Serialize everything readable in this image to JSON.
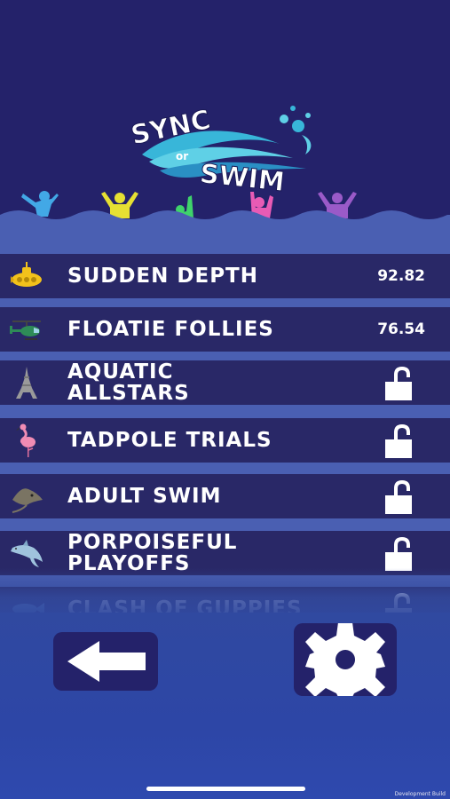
{
  "logo": {
    "text_line1": "SYNC",
    "text_line2": "or",
    "text_line3": "SWIM"
  },
  "levels": [
    {
      "name": "SUDDEN DEPTH",
      "icon": "submarine-icon",
      "score": "92.82",
      "locked": false
    },
    {
      "name": "FLOATIE FOLLIES",
      "icon": "helicopter-icon",
      "score": "76.54",
      "locked": false
    },
    {
      "name": "AQUATIC\nALLSTARS",
      "icon": "eiffel-tower-icon",
      "score": "",
      "locked": true
    },
    {
      "name": "TADPOLE TRIALS",
      "icon": "flamingo-icon",
      "score": "",
      "locked": true
    },
    {
      "name": "ADULT SWIM",
      "icon": "stingray-icon",
      "score": "",
      "locked": true
    },
    {
      "name": "PORPOISEFUL\nPLAYOFFS",
      "icon": "dolphin-icon",
      "score": "",
      "locked": true
    },
    {
      "name": "CLASH OF GUPPIES",
      "icon": "fish-icon",
      "score": "",
      "locked": true
    }
  ],
  "buttons": {
    "back": "back-arrow-icon",
    "settings": "gear-icon"
  },
  "footer": {
    "dev_build": "Development Build"
  },
  "colors": {
    "background": "#24226a",
    "row": "#292867",
    "stripe": "#4a5fb2",
    "bottom": "#3049a0"
  }
}
